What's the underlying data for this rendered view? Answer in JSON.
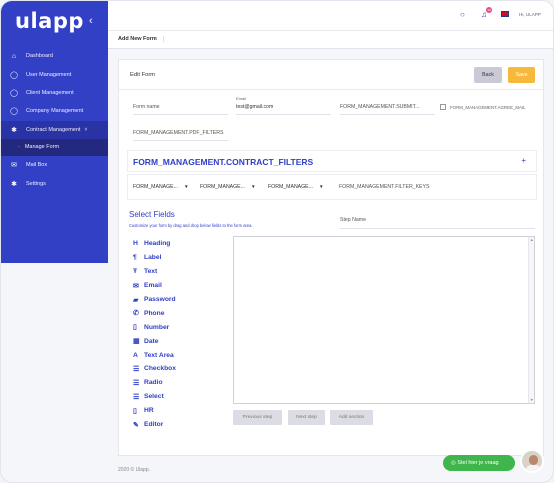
{
  "app": {
    "logo": "ulapp",
    "logo_chevron": "‹"
  },
  "sidebar": {
    "items": [
      {
        "label": "Dashboard",
        "icon": "home-icon"
      },
      {
        "label": "User Management",
        "icon": "user-icon"
      },
      {
        "label": "Client Management",
        "icon": "user-icon"
      },
      {
        "label": "Company Management",
        "icon": "user-icon"
      },
      {
        "label": "Contract Management",
        "icon": "gear-icon",
        "chevron": "˅"
      },
      {
        "label": "Manage Form"
      },
      {
        "label": "Mail Box",
        "icon": "mail-icon"
      },
      {
        "label": "Settings",
        "icon": "gear-icon"
      }
    ]
  },
  "topbar": {
    "notification_count": "10",
    "user_label": "Hi, ULAPP"
  },
  "page": {
    "header": "Add New Form"
  },
  "form": {
    "title": "Edit Form",
    "back_label": "Back",
    "save_label": "Save",
    "form_name_placeholder": "Form name",
    "email_label": "Email",
    "email_value": "test@gmail.com",
    "submit_label": "FORM_MANAGEMENT.SUBMIT...",
    "agree_label": "FORM_MANAGEMENT.AGREE_MAIL",
    "pdf_filters": "FORM_MANAGEMENT.PDF_FILTERS",
    "contract_filters": "FORM_MANAGEMENT.CONTRACT_FILTERS",
    "plus": "+",
    "selects": [
      "FORM_MANAGE...",
      "FORM_MANAGE...",
      "FORM_MANAGE..."
    ],
    "filter_keys": "FORM_MANAGEMENT.FILTER_KEYS",
    "select_fields_title": "Select Fields",
    "select_fields_desc": "Customize your form by drag and drop below fields to the form area.",
    "step_name_placeholder": "Step Name",
    "fields": [
      {
        "label": "Heading",
        "icon": "heading-icon"
      },
      {
        "label": "Label",
        "icon": "paragraph-icon"
      },
      {
        "label": "Text",
        "icon": "text-icon"
      },
      {
        "label": "Email",
        "icon": "envelope-icon"
      },
      {
        "label": "Password",
        "icon": "lock-icon"
      },
      {
        "label": "Phone",
        "icon": "phone-icon"
      },
      {
        "label": "Number",
        "icon": "mobile-icon"
      },
      {
        "label": "Date",
        "icon": "calendar-icon"
      },
      {
        "label": "Text Area",
        "icon": "font-icon"
      },
      {
        "label": "Checkbox",
        "icon": "list-icon"
      },
      {
        "label": "Radio",
        "icon": "list-icon"
      },
      {
        "label": "Select",
        "icon": "list-icon"
      },
      {
        "label": "HR",
        "icon": "mobile-icon"
      },
      {
        "label": "Editor",
        "icon": "edit-icon"
      }
    ],
    "previous_step": "Previous step",
    "next_step": "Next step",
    "add_section": "Add section"
  },
  "footer": {
    "text": "2020 © Ulapp."
  },
  "chat": {
    "label": "Stel hier je vraag"
  }
}
